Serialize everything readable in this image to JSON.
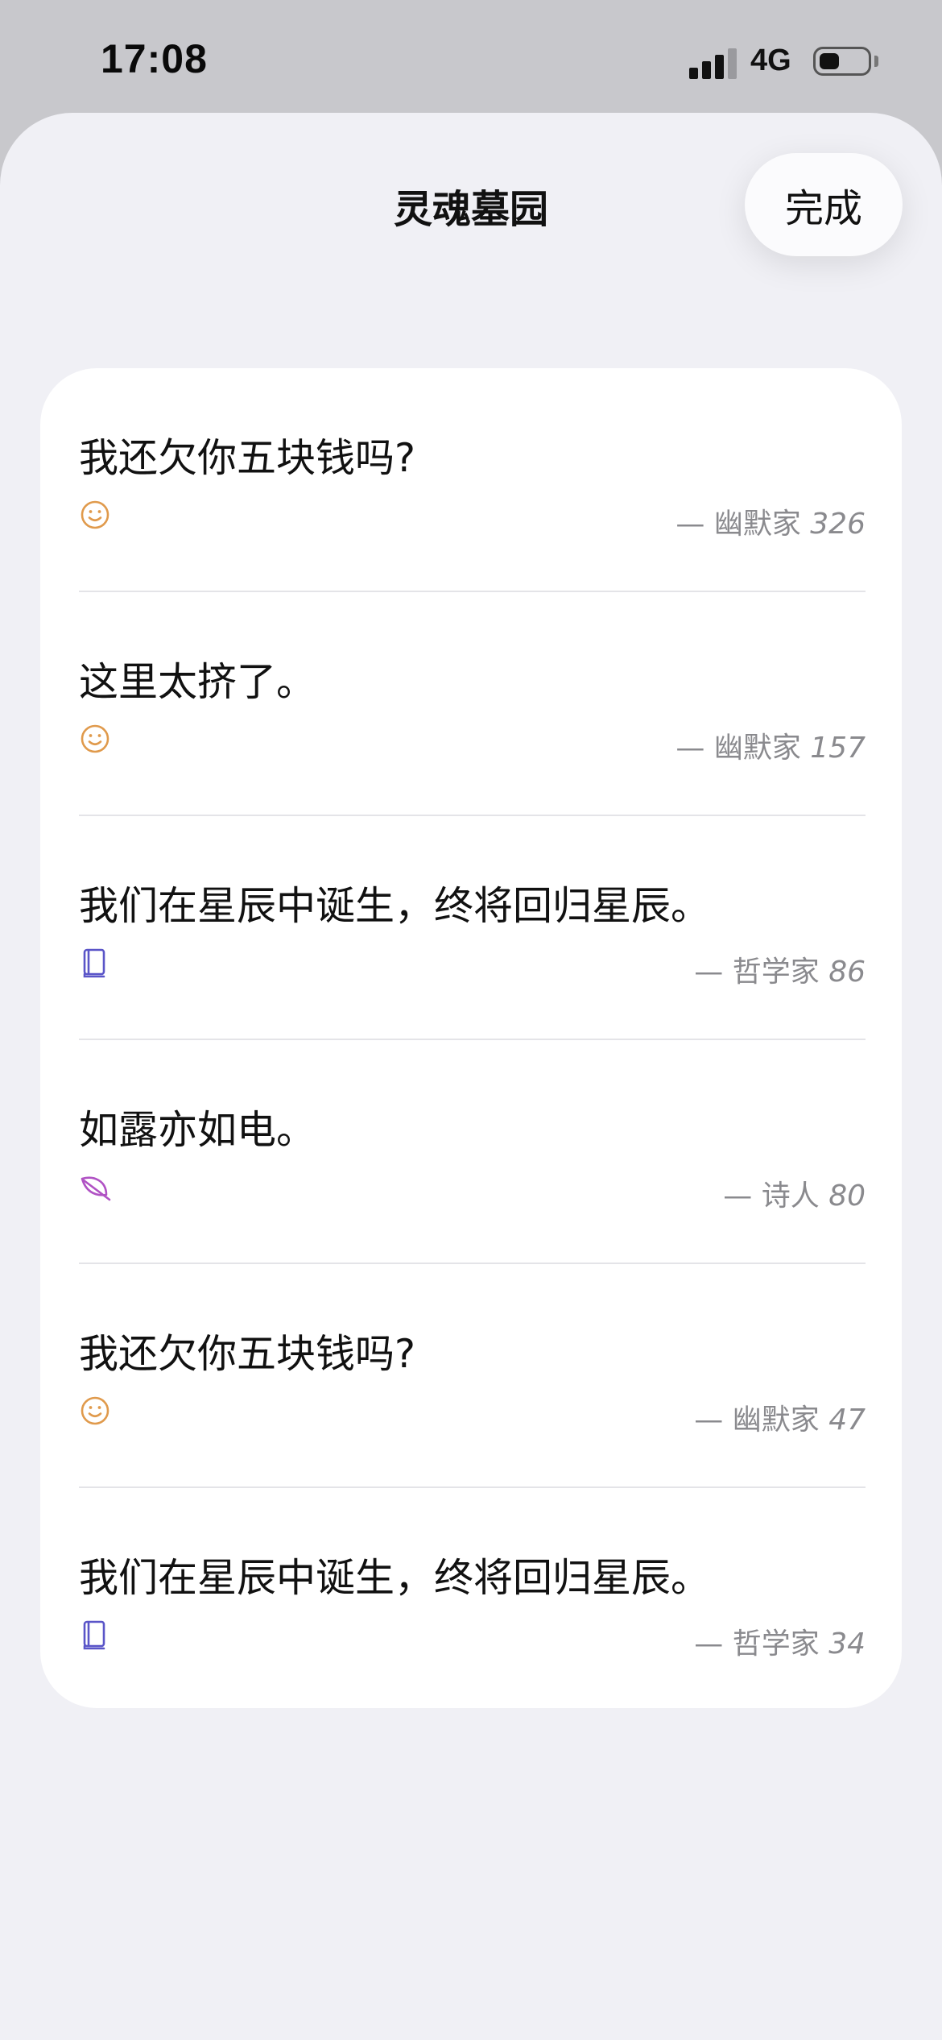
{
  "status_bar": {
    "time": "17:08",
    "network": "4G"
  },
  "header": {
    "title": "灵魂墓园",
    "done_label": "完成"
  },
  "entries": [
    {
      "text": "我还欠你五块钱吗?",
      "author": "— 幽默家",
      "count": "326",
      "icon": "smiley-icon",
      "icon_color": "#e09a4c"
    },
    {
      "text": "这里太挤了。",
      "author": "— 幽默家",
      "count": "157",
      "icon": "smiley-icon",
      "icon_color": "#e09a4c"
    },
    {
      "text": "我们在星辰中诞生，终将回归星辰。",
      "author": "— 哲学家",
      "count": "86",
      "icon": "book-icon",
      "icon_color": "#5a55c8"
    },
    {
      "text": "如露亦如电。",
      "author": "— 诗人",
      "count": "80",
      "icon": "leaf-icon",
      "icon_color": "#b052c4"
    },
    {
      "text": "我还欠你五块钱吗?",
      "author": "— 幽默家",
      "count": "47",
      "icon": "smiley-icon",
      "icon_color": "#e09a4c"
    },
    {
      "text": "我们在星辰中诞生，终将回归星辰。",
      "author": "— 哲学家",
      "count": "34",
      "icon": "book-icon",
      "icon_color": "#5a55c8"
    }
  ]
}
